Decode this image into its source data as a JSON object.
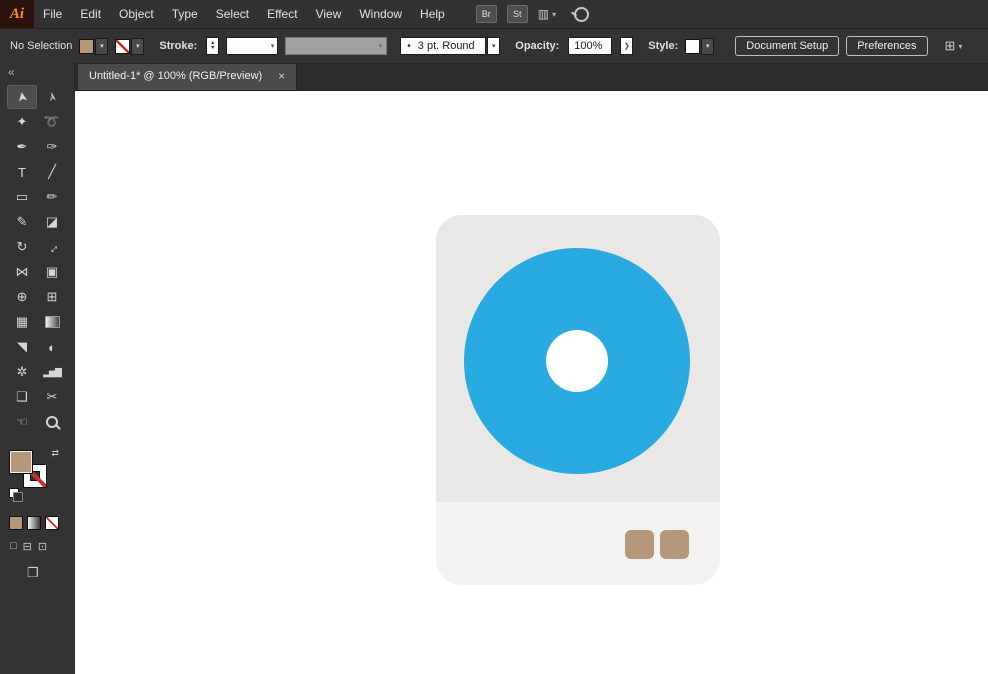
{
  "menubar": {
    "logo": "Ai",
    "items": [
      "File",
      "Edit",
      "Object",
      "Type",
      "Select",
      "Effect",
      "View",
      "Window",
      "Help"
    ],
    "br_label": "Br",
    "st_label": "St"
  },
  "controlbar": {
    "no_selection_label": "No Selection",
    "stroke_label": "Stroke:",
    "variable_width_value": "3 pt. Round",
    "opacity_label": "Opacity:",
    "opacity_value": "100%",
    "style_label": "Style:",
    "document_setup_label": "Document Setup",
    "preferences_label": "Preferences"
  },
  "tabbar": {
    "tab_title": "Untitled-1* @ 100% (RGB/Preview)"
  },
  "glyphs": {
    "chevron_down": "▾",
    "stepper_up": "▴",
    "stepper_down": "▾",
    "flyout_arrow": "❯",
    "brush_dot": "•",
    "collapse": "«",
    "close": "×",
    "swap": "⇄",
    "workspace": "▥",
    "align": "⊞"
  },
  "toolbar": {
    "tools": [
      {
        "name": "selection-tool",
        "glyph": "➤"
      },
      {
        "name": "direct-selection-tool",
        "glyph": "➢"
      },
      {
        "name": "magic-wand-tool",
        "glyph": "✦"
      },
      {
        "name": "lasso-tool",
        "glyph": "➰"
      },
      {
        "name": "pen-tool",
        "glyph": "✒"
      },
      {
        "name": "curvature-tool",
        "glyph": "✑"
      },
      {
        "name": "type-tool",
        "glyph": "T"
      },
      {
        "name": "line-segment-tool",
        "glyph": "╱"
      },
      {
        "name": "rectangle-tool",
        "glyph": "▭"
      },
      {
        "name": "paintbrush-tool",
        "glyph": "✏"
      },
      {
        "name": "shaper-tool",
        "glyph": "✎"
      },
      {
        "name": "eraser-tool",
        "glyph": "◪"
      },
      {
        "name": "rotate-tool",
        "glyph": "↻"
      },
      {
        "name": "scale-tool",
        "glyph": "↔"
      },
      {
        "name": "width-tool",
        "glyph": "⋈"
      },
      {
        "name": "free-transform-tool",
        "glyph": "▣"
      },
      {
        "name": "shape-builder-tool",
        "glyph": "⊕"
      },
      {
        "name": "perspective-grid-tool",
        "glyph": "⊞"
      },
      {
        "name": "mesh-tool",
        "glyph": "▦"
      },
      {
        "name": "gradient-tool",
        "glyph": ""
      },
      {
        "name": "eyedropper-tool",
        "glyph": "◥"
      },
      {
        "name": "blend-tool",
        "glyph": "◐"
      },
      {
        "name": "symbol-sprayer-tool",
        "glyph": "✲"
      },
      {
        "name": "column-graph-tool",
        "glyph": "▂▅▇"
      },
      {
        "name": "artboard-tool",
        "glyph": "❏"
      },
      {
        "name": "slice-tool",
        "glyph": "✂"
      },
      {
        "name": "hand-tool",
        "glyph": "☜"
      },
      {
        "name": "zoom-tool",
        "glyph": ""
      }
    ],
    "modes": [
      "□",
      "⊟",
      "⊡"
    ],
    "screen_mode_glyph": "❐"
  },
  "colors": {
    "fill_swatch": "#b5987a",
    "artwork_blue": "#29abe2",
    "artwork_body_gray": "#e9e8e6",
    "artwork_strip_gray": "#f3f2f0",
    "artwork_button_tan": "#b5987a",
    "none_slash_red": "#d42a2a"
  }
}
